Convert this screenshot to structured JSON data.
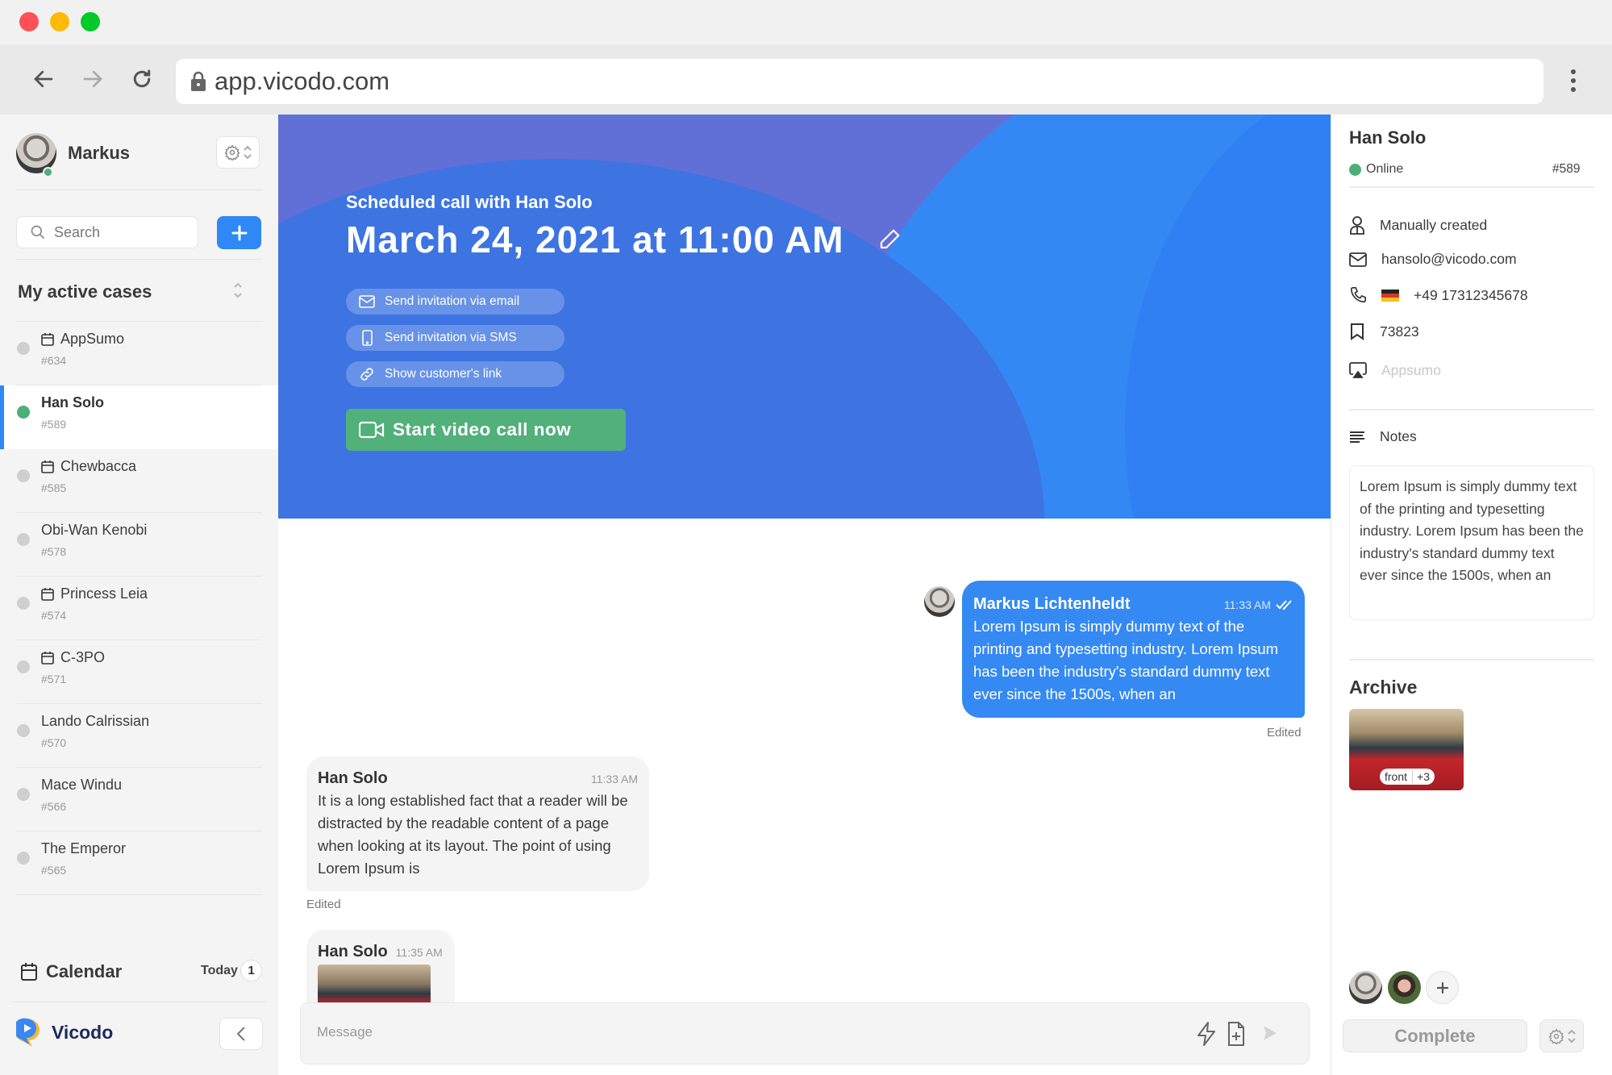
{
  "browser": {
    "url": "app.vicodo.com",
    "traffic_colors": [
      "#ff5057",
      "#ffba08",
      "#00c92a"
    ]
  },
  "sidebar": {
    "user_name": "Markus",
    "user_status": "online",
    "search_placeholder": "Search",
    "add_label": "+",
    "cases_title": "My active cases",
    "cases": [
      {
        "name": "AppSumo",
        "number": "#634",
        "status": "offline",
        "scheduled": true,
        "active": false
      },
      {
        "name": "Han Solo",
        "number": "#589",
        "status": "online",
        "scheduled": false,
        "active": true
      },
      {
        "name": "Chewbacca",
        "number": "#585",
        "status": "offline",
        "scheduled": true,
        "active": false
      },
      {
        "name": "Obi-Wan Kenobi",
        "number": "#578",
        "status": "offline",
        "scheduled": false,
        "active": false
      },
      {
        "name": "Princess Leia",
        "number": "#574",
        "status": "offline",
        "scheduled": true,
        "active": false
      },
      {
        "name": "C-3PO",
        "number": "#571",
        "status": "offline",
        "scheduled": true,
        "active": false
      },
      {
        "name": "Lando Calrissian",
        "number": "#570",
        "status": "offline",
        "scheduled": false,
        "active": false
      },
      {
        "name": "Mace Windu",
        "number": "#566",
        "status": "offline",
        "scheduled": false,
        "active": false
      },
      {
        "name": "The Emperor",
        "number": "#565",
        "status": "offline",
        "scheduled": false,
        "active": false
      }
    ],
    "calendar_label": "Calendar",
    "today_label": "Today",
    "today_count": "1",
    "brand_name": "Vicodo"
  },
  "banner": {
    "subtitle": "Scheduled call with Han Solo",
    "datetime": "March 24, 2021 at 11:00 AM",
    "actions": [
      {
        "label": "Send invitation via email",
        "icon": "mail-icon"
      },
      {
        "label": "Send invitation via SMS",
        "icon": "phone-icon"
      },
      {
        "label": "Show customer's link",
        "icon": "link-icon"
      }
    ],
    "cta_label": "Start video call now"
  },
  "chat": {
    "messages": [
      {
        "author": "Markus Lichtenheldt",
        "time": "11:33 AM",
        "text": "Lorem Ipsum is simply dummy text of the printing and typesetting industry. Lorem Ipsum has been the industry's standard dummy text ever since the 1500s, when an",
        "direction": "outgoing",
        "read": true,
        "edited_label": "Edited"
      },
      {
        "author": "Han Solo",
        "time": "11:33 AM",
        "text": "It is a long established fact that a reader will be distracted by the readable content of a page when looking at its layout. The point of using Lorem Ipsum is",
        "direction": "incoming",
        "edited_label": "Edited"
      },
      {
        "author": "Han Solo",
        "time": "11:35 AM",
        "text": "",
        "direction": "incoming",
        "attachment": "image"
      }
    ],
    "input_placeholder": "Message"
  },
  "contact": {
    "name": "Han Solo",
    "status": "Online",
    "case_number": "#589",
    "source": "Manually created",
    "email": "hansolo@vicodo.com",
    "phone": "+49 17312345678",
    "phone_country": "DE",
    "reference": "73823",
    "company_placeholder": "Appsumo",
    "notes_label": "Notes",
    "notes": "Lorem Ipsum is simply dummy text of the printing and typesetting industry. Lorem Ipsum has been the industry's standard dummy text ever since the 1500s, when an",
    "archive_title": "Archive",
    "archive_tag": "front",
    "archive_more": "+3",
    "complete_label": "Complete"
  },
  "colors": {
    "accent": "#2f88f5",
    "online": "#4caf78",
    "cta": "#52b07a",
    "bubble_out": "#3589f2"
  }
}
